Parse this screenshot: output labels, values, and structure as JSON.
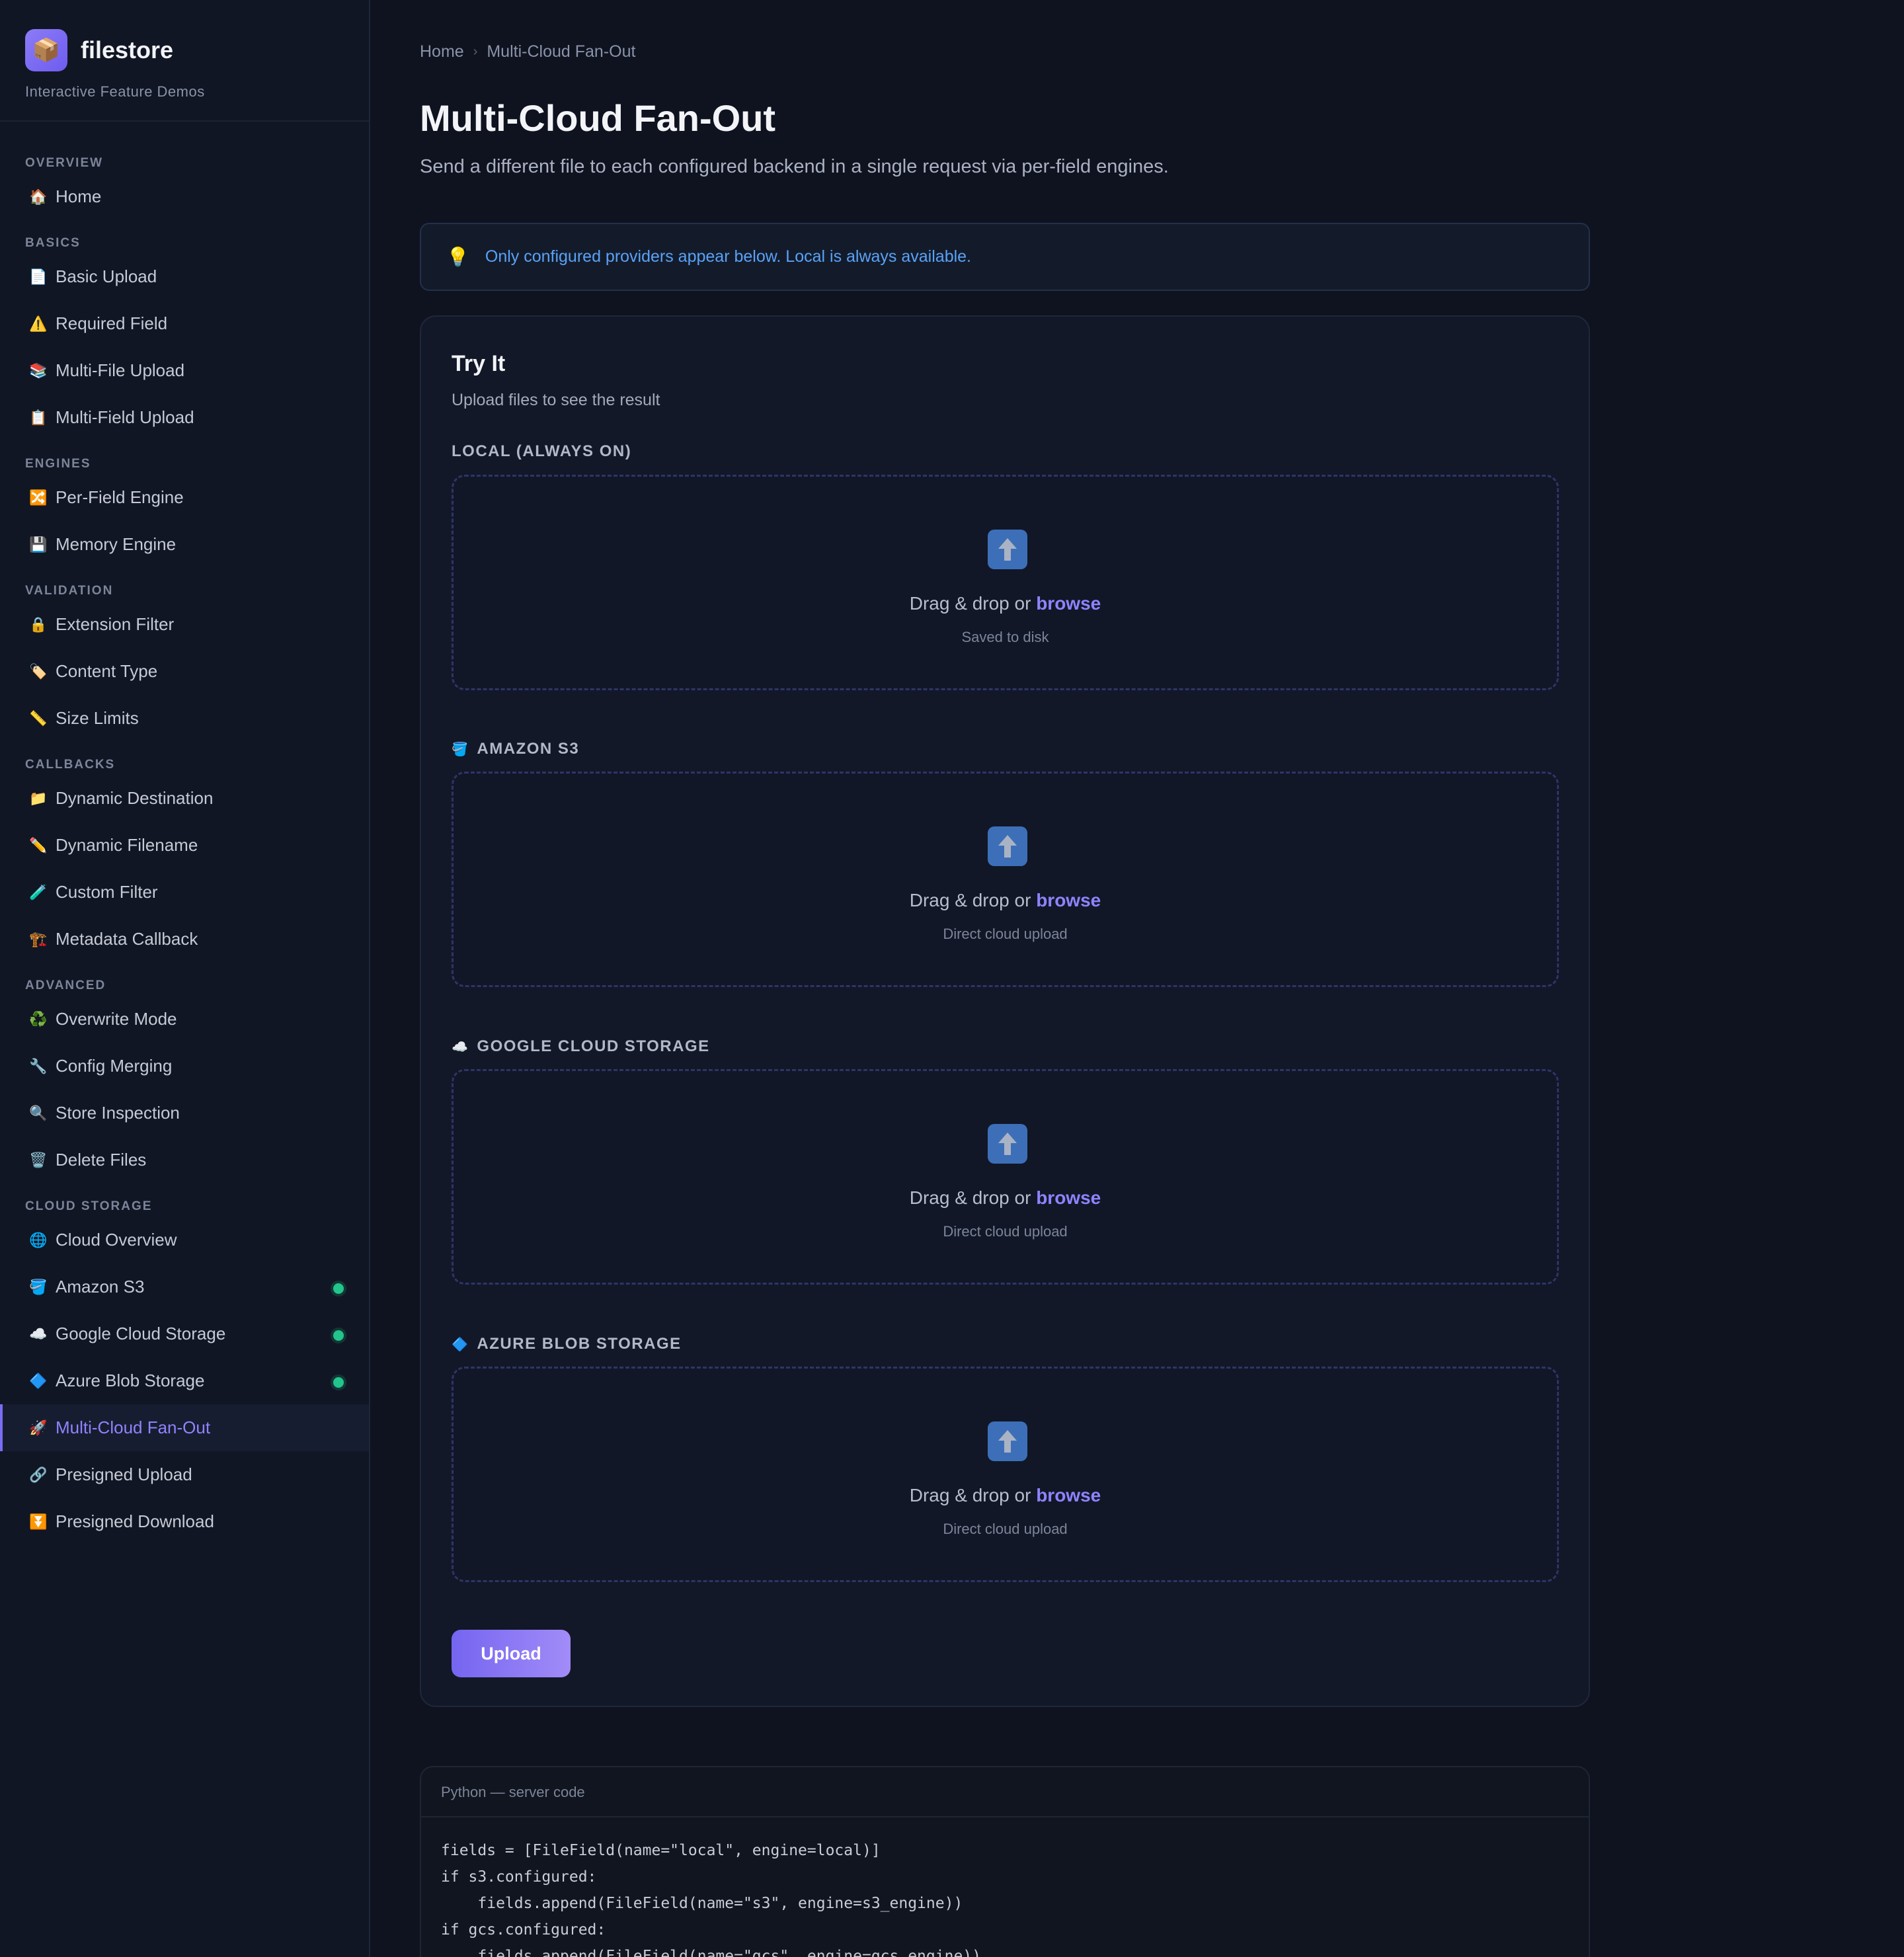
{
  "brand": {
    "logo_icon": "📦",
    "name": "filestore",
    "subtitle": "Interactive Feature Demos"
  },
  "sidebar": {
    "sections": [
      {
        "title": "OVERVIEW",
        "items": [
          {
            "icon": "🏠",
            "label": "Home"
          }
        ]
      },
      {
        "title": "BASICS",
        "items": [
          {
            "icon": "📄",
            "label": "Basic Upload"
          },
          {
            "icon": "⚠️",
            "label": "Required Field"
          },
          {
            "icon": "📚",
            "label": "Multi-File Upload"
          },
          {
            "icon": "📋",
            "label": "Multi-Field Upload"
          }
        ]
      },
      {
        "title": "ENGINES",
        "items": [
          {
            "icon": "🔀",
            "label": "Per-Field Engine"
          },
          {
            "icon": "💾",
            "label": "Memory Engine"
          }
        ]
      },
      {
        "title": "VALIDATION",
        "items": [
          {
            "icon": "🔒",
            "label": "Extension Filter"
          },
          {
            "icon": "🏷️",
            "label": "Content Type"
          },
          {
            "icon": "📏",
            "label": "Size Limits"
          }
        ]
      },
      {
        "title": "CALLBACKS",
        "items": [
          {
            "icon": "📁",
            "label": "Dynamic Destination"
          },
          {
            "icon": "✏️",
            "label": "Dynamic Filename"
          },
          {
            "icon": "🧪",
            "label": "Custom Filter"
          },
          {
            "icon": "🏗️",
            "label": "Metadata Callback"
          }
        ]
      },
      {
        "title": "ADVANCED",
        "items": [
          {
            "icon": "♻️",
            "label": "Overwrite Mode"
          },
          {
            "icon": "🔧",
            "label": "Config Merging"
          },
          {
            "icon": "🔍",
            "label": "Store Inspection"
          },
          {
            "icon": "🗑️",
            "label": "Delete Files"
          }
        ]
      },
      {
        "title": "CLOUD STORAGE",
        "items": [
          {
            "icon": "🌐",
            "label": "Cloud Overview"
          },
          {
            "icon": "🪣",
            "label": "Amazon S3",
            "status": "configured"
          },
          {
            "icon": "☁️",
            "label": "Google Cloud Storage",
            "status": "configured"
          },
          {
            "icon": "🔷",
            "label": "Azure Blob Storage",
            "status": "configured"
          },
          {
            "icon": "🚀",
            "label": "Multi-Cloud Fan-Out",
            "active": true
          },
          {
            "icon": "🔗",
            "label": "Presigned Upload"
          },
          {
            "icon": "⏬",
            "label": "Presigned Download"
          }
        ]
      }
    ]
  },
  "breadcrumb": {
    "home": "Home",
    "separator": "›",
    "current": "Multi-Cloud Fan-Out"
  },
  "page": {
    "title": "Multi-Cloud Fan-Out",
    "description": "Send a different file to each configured backend in a single request via per-field engines."
  },
  "tip": {
    "icon": "💡",
    "text": "Only configured providers appear below. Local is always available."
  },
  "try_it": {
    "title": "Try It",
    "subtitle": "Upload files to see the result",
    "fields": [
      {
        "icon": "",
        "label": "LOCAL (ALWAYS ON)",
        "drop_text": "Drag & drop or",
        "browse": "browse",
        "hint": "Saved to disk"
      },
      {
        "icon": "🪣",
        "label": "AMAZON S3",
        "drop_text": "Drag & drop or",
        "browse": "browse",
        "hint": "Direct cloud upload"
      },
      {
        "icon": "☁️",
        "label": "GOOGLE CLOUD STORAGE",
        "drop_text": "Drag & drop or",
        "browse": "browse",
        "hint": "Direct cloud upload"
      },
      {
        "icon": "🔷",
        "label": "AZURE BLOB STORAGE",
        "drop_text": "Drag & drop or",
        "browse": "browse",
        "hint": "Direct cloud upload"
      }
    ],
    "upload_label": "Upload"
  },
  "code": {
    "header": "Python — server code",
    "lines": [
      "fields = [FileField(name=\"local\", engine=local)]",
      "if s3.configured:",
      "    fields.append(FileField(name=\"s3\", engine=s3_engine))",
      "if gcs.configured:",
      "    fields.append(FileField(name=\"gcs\", engine=gcs_engine))"
    ]
  },
  "colors": {
    "accent": "#7b6cf6",
    "status_ok": "#22c58b",
    "info": "#5aa2f5",
    "background": "#0f1320"
  }
}
